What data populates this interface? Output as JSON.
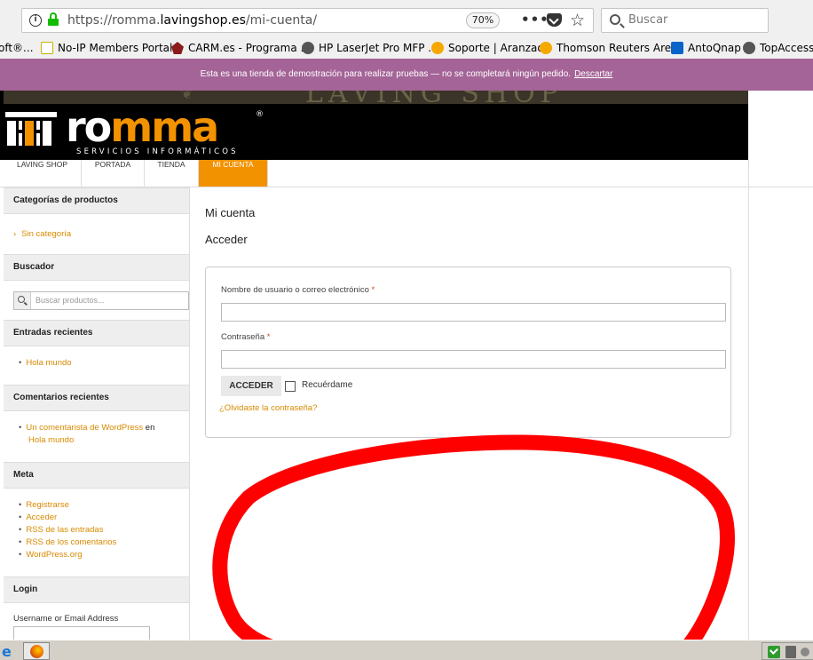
{
  "browser": {
    "url_prefix": "https://romma.",
    "url_domain": "lavingshop.es",
    "url_path": "/mi-cuenta/",
    "zoom": "70%",
    "search_placeholder": "Buscar"
  },
  "bookmarks": [
    {
      "label": "oft®..."
    },
    {
      "label": "No-IP Members Portal..."
    },
    {
      "label": "CARM.es - Programa ..."
    },
    {
      "label": "HP LaserJet Pro MFP ..."
    },
    {
      "label": "Soporte | Aranzadi"
    },
    {
      "label": "Thomson Reuters Are..."
    },
    {
      "label": "AntoQnap"
    },
    {
      "label": "TopAccess"
    }
  ],
  "notice": {
    "text": "Esta es una tienda de demostración para realizar pruebas — no se completará ningún pedido.",
    "dismiss": "Descartar"
  },
  "header": {
    "banner_text": "LAVING SHOP",
    "logo_word_a": "ro",
    "logo_word_b": "mma",
    "logo_reg": "®",
    "logo_sub": "SERVICIOS INFORMÁTICOS"
  },
  "nav": [
    {
      "label": "LAVING SHOP"
    },
    {
      "label": "PORTADA"
    },
    {
      "label": "TIENDA"
    },
    {
      "label": "MI CUENTA",
      "active": true
    }
  ],
  "sidebar": {
    "categories_title": "Categorías de productos",
    "categories": [
      "Sin categoría"
    ],
    "search_title": "Buscador",
    "search_placeholder": "Buscar productos...",
    "recent_title": "Entradas recientes",
    "recent": [
      "Hola mundo"
    ],
    "comments_title": "Comentarios recientes",
    "comment_author": "Un comentarista de WordPress",
    "comment_on": "en",
    "comment_post": "Hola mundo",
    "meta_title": "Meta",
    "meta": [
      "Registrarse",
      "Acceder",
      "RSS de las entradas",
      "RSS de los comentarios",
      "WordPress.org"
    ],
    "login_title": "Login",
    "login_label": "Username or Email Address"
  },
  "main": {
    "page_title": "Mi cuenta",
    "section_title": "Acceder",
    "username_label": "Nombre de usuario o correo electrónico",
    "password_label": "Contraseña",
    "required_mark": "*",
    "login_button": "ACCEDER",
    "remember_label": "Recuérdame",
    "lost_password": "¿Olvidaste la contraseña?"
  },
  "colors": {
    "accent": "#f39200",
    "notice_bg": "#a46497",
    "annotation": "#ff0000"
  }
}
